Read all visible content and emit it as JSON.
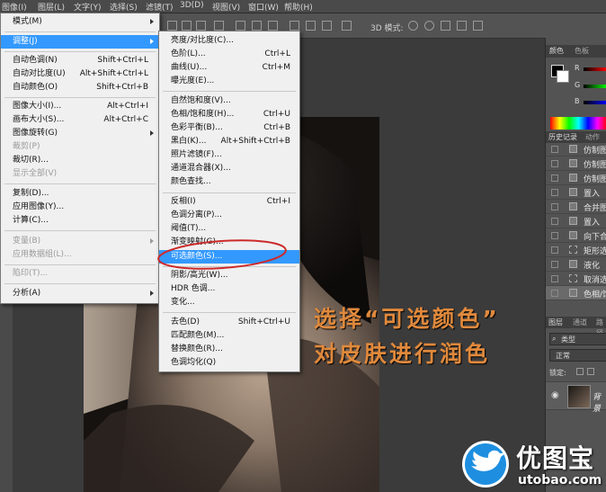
{
  "menubar": {
    "items": [
      "图像(I)",
      "图层(L)",
      "文字(Y)",
      "选择(S)",
      "滤镜(T)",
      "3D(D)",
      "视图(V)",
      "窗口(W)",
      "帮助(H)"
    ]
  },
  "optionsbar": {
    "mode_label": "3D 模式:"
  },
  "image_menu": {
    "items": [
      {
        "label": "模式(M)",
        "submenu": true
      },
      {
        "label": "调整(J)",
        "submenu": true,
        "selected": true
      },
      {
        "label": "自动色调(N)",
        "shortcut": "Shift+Ctrl+L"
      },
      {
        "label": "自动对比度(U)",
        "shortcut": "Alt+Shift+Ctrl+L"
      },
      {
        "label": "自动颜色(O)",
        "shortcut": "Shift+Ctrl+B"
      },
      {
        "label": "图像大小(I)...",
        "shortcut": "Alt+Ctrl+I"
      },
      {
        "label": "画布大小(S)...",
        "shortcut": "Alt+Ctrl+C"
      },
      {
        "label": "图像旋转(G)",
        "submenu": true
      },
      {
        "label": "裁剪(P)",
        "disabled": true
      },
      {
        "label": "裁切(R)..."
      },
      {
        "label": "显示全部(V)",
        "disabled": true
      },
      {
        "label": "复制(D)..."
      },
      {
        "label": "应用图像(Y)..."
      },
      {
        "label": "计算(C)..."
      },
      {
        "label": "变量(B)",
        "submenu": true,
        "disabled": true
      },
      {
        "label": "应用数据组(L)...",
        "disabled": true
      },
      {
        "label": "陷印(T)...",
        "disabled": true
      },
      {
        "label": "分析(A)",
        "submenu": true
      }
    ]
  },
  "adjust_menu": {
    "items": [
      {
        "label": "亮度/对比度(C)..."
      },
      {
        "label": "色阶(L)...",
        "shortcut": "Ctrl+L"
      },
      {
        "label": "曲线(U)...",
        "shortcut": "Ctrl+M"
      },
      {
        "label": "曝光度(E)..."
      },
      {
        "label": "自然饱和度(V)..."
      },
      {
        "label": "色相/饱和度(H)...",
        "shortcut": "Ctrl+U"
      },
      {
        "label": "色彩平衡(B)...",
        "shortcut": "Ctrl+B"
      },
      {
        "label": "黑白(K)...",
        "shortcut": "Alt+Shift+Ctrl+B"
      },
      {
        "label": "照片滤镜(F)..."
      },
      {
        "label": "通道混合器(X)..."
      },
      {
        "label": "颜色查找..."
      },
      {
        "label": "反相(I)",
        "shortcut": "Ctrl+I"
      },
      {
        "label": "色调分离(P)..."
      },
      {
        "label": "阈值(T)..."
      },
      {
        "label": "渐变映射(G)..."
      },
      {
        "label": "可选颜色(S)...",
        "selected": true
      },
      {
        "label": "阴影/高光(W)..."
      },
      {
        "label": "HDR 色调..."
      },
      {
        "label": "变化..."
      },
      {
        "label": "去色(D)",
        "shortcut": "Shift+Ctrl+U"
      },
      {
        "label": "匹配颜色(M)..."
      },
      {
        "label": "替换颜色(R)..."
      },
      {
        "label": "色调均化(Q)"
      }
    ]
  },
  "color_panel": {
    "tabs": [
      "颜色",
      "色板"
    ],
    "channels": [
      "R",
      "G",
      "B"
    ]
  },
  "history_panel": {
    "tabs": [
      "历史记录",
      "动作"
    ],
    "items": [
      "仿制图",
      "仿制图",
      "仿制图",
      "置入",
      "合并图",
      "置入",
      "向下合",
      "矩形选",
      "液化",
      "取消选",
      "色相/饱"
    ]
  },
  "layers_panel": {
    "tabs": [
      "图层",
      "通道",
      "路径"
    ],
    "filter_label": "类型",
    "blend_mode": "正常",
    "lock_label": "锁定:",
    "layer_name": "背景"
  },
  "annotation": {
    "line1": "选择“可选颜色”",
    "line2": "对皮肤进行润色"
  },
  "watermark": {
    "brand": "优图宝",
    "url": "utobao.com"
  },
  "colors": {
    "menu_highlight": "#3399ff",
    "annotation": "#e0893c",
    "circle": "#cc2a2a",
    "watermark_blue": "#1e8fe0"
  }
}
